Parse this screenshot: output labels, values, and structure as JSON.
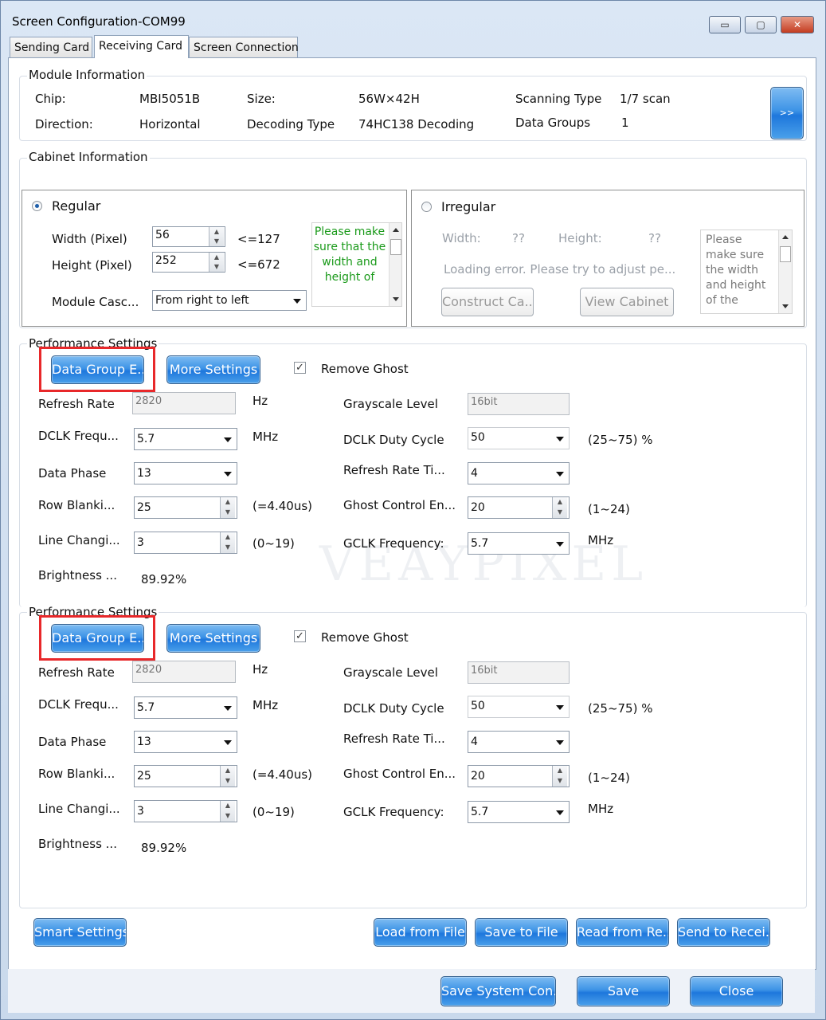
{
  "window": {
    "title": "Screen Configuration-COM99",
    "minimize": "▭",
    "maximize": "▢",
    "close": "✕"
  },
  "tabs": [
    "Sending Card",
    "Receiving Card",
    "Screen Connection"
  ],
  "module_info": {
    "legend": "Module Information",
    "chip_label": "Chip:",
    "chip_value": "MBI5051B",
    "size_label": "Size:",
    "size_value": "56W×42H",
    "scan_label": "Scanning Type",
    "scan_value": "1/7 scan",
    "direction_label": "Direction:",
    "direction_value": "Horizontal",
    "decoding_label": "Decoding Type",
    "decoding_value": "74HC138 Decoding",
    "groups_label": "Data Groups",
    "groups_value": "1",
    "expand_button": ">>"
  },
  "cabinet_info": {
    "legend": "Cabinet Information",
    "regular": {
      "label": "Regular",
      "width_label": "Width (Pixel)",
      "width_value": "56",
      "width_max": "<=127",
      "height_label": "Height (Pixel)",
      "height_value": "252",
      "height_max": "<=672",
      "cascade_label": "Module Casc...",
      "cascade_value": "From right to left",
      "note": "Please make sure that the width and height of"
    },
    "irregular": {
      "label": "Irregular",
      "width_label": "Width:",
      "width_value": "??",
      "height_label": "Height:",
      "height_value": "??",
      "error": "Loading error. Please try to adjust pe...",
      "construct_button": "Construct Ca...",
      "view_button": "View Cabinet",
      "note": "Please make sure the width and height of the"
    }
  },
  "performance_sections": [
    {
      "legend": "Performance Settings",
      "data_group_button": "Data Group E...",
      "more_settings_button": "More Settings",
      "remove_ghost_label": "Remove Ghost",
      "remove_ghost_checked": "✓",
      "refresh_rate_label": "Refresh Rate",
      "refresh_rate_value": "2820",
      "refresh_rate_unit": "Hz",
      "grayscale_label": "Grayscale Level",
      "grayscale_value": "16bit",
      "dclk_freq_label": "DCLK Frequ...",
      "dclk_freq_value": "5.7",
      "dclk_freq_unit": "MHz",
      "dclk_duty_label": "DCLK Duty Cycle",
      "dclk_duty_value": "50",
      "dclk_duty_range": "(25~75) %",
      "data_phase_label": "Data Phase",
      "data_phase_value": "13",
      "refresh_times_label": "Refresh Rate Ti...",
      "refresh_times_value": "4",
      "row_blanking_label": "Row Blanki...",
      "row_blanking_value": "25",
      "row_blanking_note": "(=4.40us)",
      "ghost_control_label": "Ghost Control En...",
      "ghost_control_value": "20",
      "ghost_control_range": "(1~24)",
      "line_change_label": "Line Changi...",
      "line_change_value": "3",
      "line_change_range": "(0~19)",
      "gclk_label": "GCLK Frequency:",
      "gclk_value": "5.7",
      "gclk_unit": "MHz",
      "brightness_label": "Brightness ...",
      "brightness_value": "89.92%"
    },
    {
      "legend": "Performance Settings",
      "data_group_button": "Data Group E...",
      "more_settings_button": "More Settings",
      "remove_ghost_label": "Remove Ghost",
      "remove_ghost_checked": "✓",
      "refresh_rate_label": "Refresh Rate",
      "refresh_rate_value": "2820",
      "refresh_rate_unit": "Hz",
      "grayscale_label": "Grayscale Level",
      "grayscale_value": "16bit",
      "dclk_freq_label": "DCLK Frequ...",
      "dclk_freq_value": "5.7",
      "dclk_freq_unit": "MHz",
      "dclk_duty_label": "DCLK Duty Cycle",
      "dclk_duty_value": "50",
      "dclk_duty_range": "(25~75) %",
      "data_phase_label": "Data Phase",
      "data_phase_value": "13",
      "refresh_times_label": "Refresh Rate Ti...",
      "refresh_times_value": "4",
      "row_blanking_label": "Row Blanki...",
      "row_blanking_value": "25",
      "row_blanking_note": "(=4.40us)",
      "ghost_control_label": "Ghost Control En...",
      "ghost_control_value": "20",
      "ghost_control_range": "(1~24)",
      "line_change_label": "Line Changi...",
      "line_change_value": "3",
      "line_change_range": "(0~19)",
      "gclk_label": "GCLK Frequency:",
      "gclk_value": "5.7",
      "gclk_unit": "MHz",
      "brightness_label": "Brightness ...",
      "brightness_value": "89.92%"
    }
  ],
  "file_actions": {
    "smart_settings": "Smart Settings",
    "load_from_file": "Load from File",
    "save_to_file": "Save to File",
    "read_from_receiver": "Read from Re...",
    "send_to_receiver": "Send to Recei..."
  },
  "footer": {
    "save_system_config": "Save System Con...",
    "save": "Save",
    "close": "Close"
  }
}
